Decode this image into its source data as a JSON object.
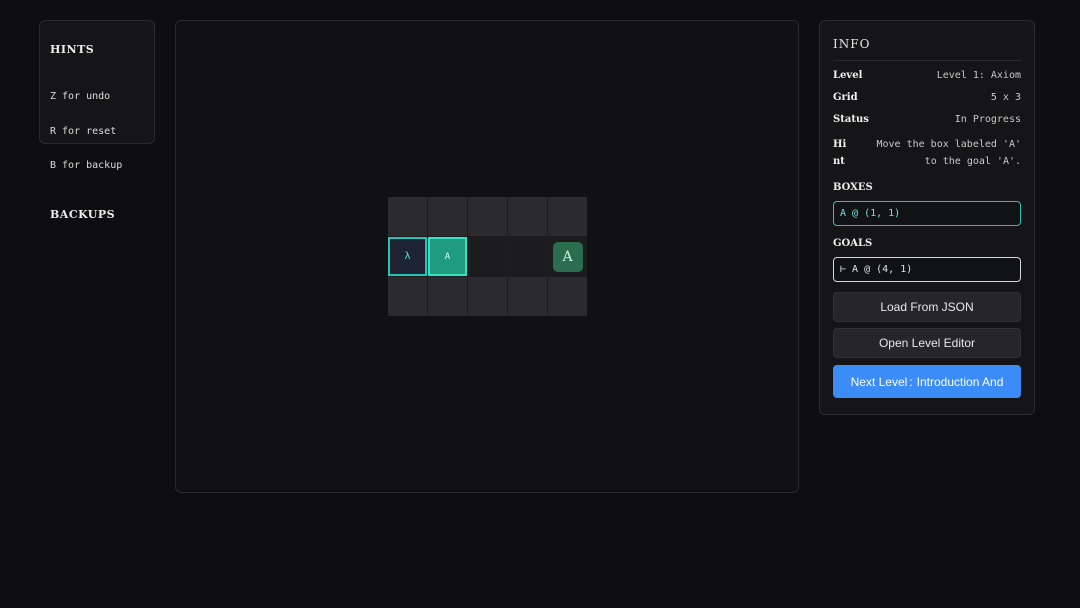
{
  "hints": {
    "title": "HINTS",
    "lines": [
      "Z for undo",
      "R for reset",
      "B for backup"
    ],
    "backups_title": "BACKUPS"
  },
  "board": {
    "cols": 5,
    "rows": 3,
    "player_symbol": "λ",
    "box_label": "A",
    "goal_label": "A"
  },
  "info": {
    "title": "INFO",
    "rows": [
      {
        "key": "Level",
        "value": "Level 1: Axiom"
      },
      {
        "key": "Grid",
        "value": "5 x 3"
      },
      {
        "key": "Status",
        "value": "In Progress"
      }
    ],
    "hint_key": "Hint",
    "hint_value": "Move the box labeled 'A' to the goal 'A'.",
    "boxes_title": "BOXES",
    "boxes_value": "A @ (1, 1)",
    "goals_title": "GOALS",
    "goals_value": "⊢ A @ (4, 1)",
    "load_button": "Load From JSON",
    "editor_button": "Open Level Editor",
    "next_label": "Next Level",
    "next_sep": ":",
    "next_level_name": "Introduction And"
  },
  "colors": {
    "accent_teal": "#22c5bc",
    "box_fill": "#1f9b7e",
    "goal_fill": "#2a6e4f",
    "next_button": "#3b8cf6"
  }
}
